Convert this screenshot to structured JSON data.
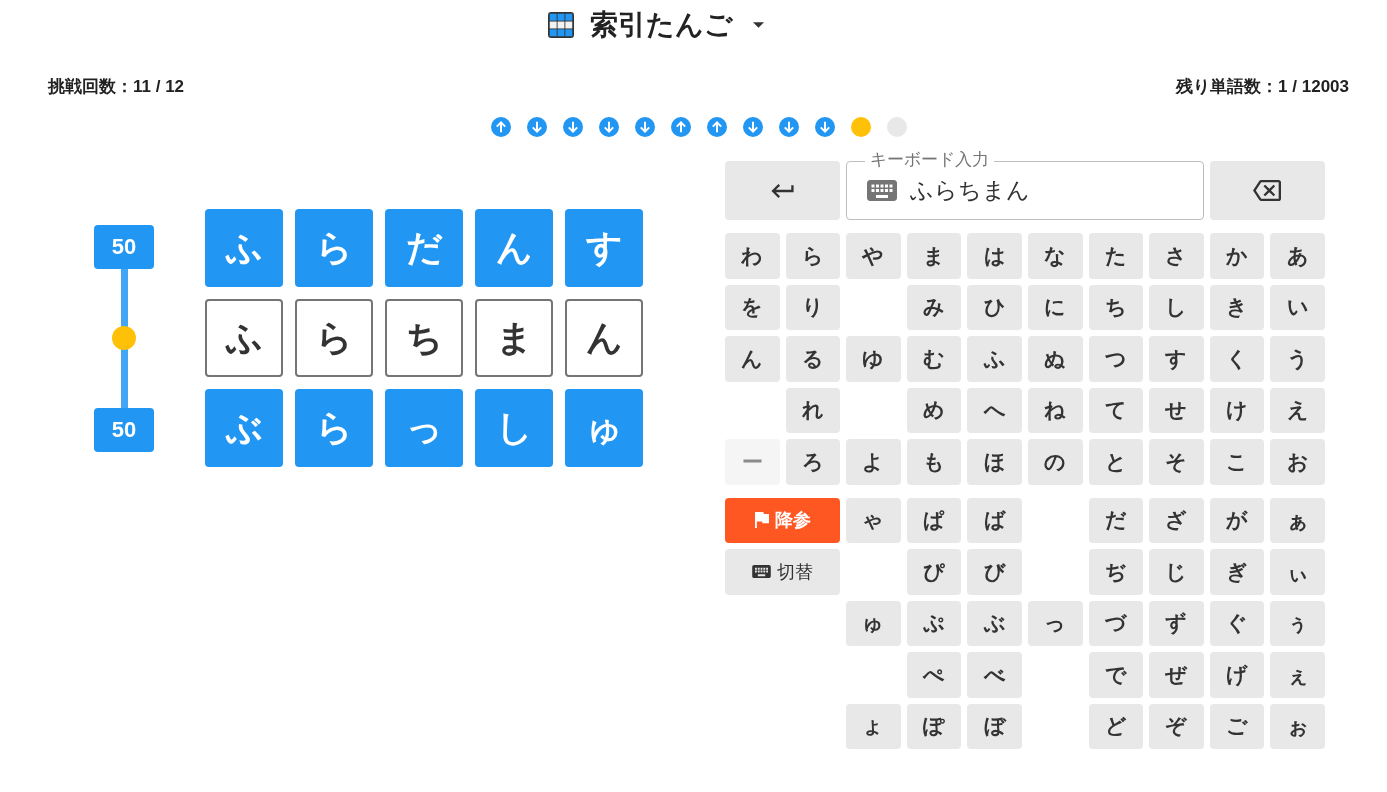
{
  "header": {
    "title": "索引たんご"
  },
  "stats": {
    "attempts": "挑戦回数：11 / 12",
    "remaining_words": "残り単語数：1 / 12003"
  },
  "attempt_history": [
    {
      "kind": "up"
    },
    {
      "kind": "down"
    },
    {
      "kind": "down"
    },
    {
      "kind": "down"
    },
    {
      "kind": "down"
    },
    {
      "kind": "up"
    },
    {
      "kind": "up"
    },
    {
      "kind": "down"
    },
    {
      "kind": "down"
    },
    {
      "kind": "down"
    },
    {
      "kind": "current"
    },
    {
      "kind": "pending"
    }
  ],
  "range_slider": {
    "upper_label": "50",
    "lower_label": "50",
    "level": 0.5
  },
  "word_grid": [
    {
      "kind": "bound",
      "tiles": [
        "ふ",
        "ら",
        "だ",
        "ん",
        "す"
      ]
    },
    {
      "kind": "guess",
      "tiles": [
        "ふ",
        "ら",
        "ち",
        "ま",
        "ん"
      ]
    },
    {
      "kind": "bound",
      "tiles": [
        "ぶ",
        "ら",
        "っ",
        "し",
        "ゅ"
      ]
    }
  ],
  "keyboard": {
    "input": {
      "label": "キーボード入力",
      "value": "ふらちまん"
    },
    "kana_rows": [
      [
        {
          "label": "わ",
          "disabled": false
        },
        {
          "label": "ら",
          "disabled": false
        },
        {
          "label": "や",
          "disabled": false
        },
        {
          "label": "ま",
          "disabled": false
        },
        {
          "label": "は",
          "disabled": false
        },
        {
          "label": "な",
          "disabled": false
        },
        {
          "label": "た",
          "disabled": false
        },
        {
          "label": "さ",
          "disabled": false
        },
        {
          "label": "か",
          "disabled": false
        },
        {
          "label": "あ",
          "disabled": false
        }
      ],
      [
        {
          "label": "を",
          "disabled": false
        },
        {
          "label": "り",
          "disabled": false
        },
        null,
        {
          "label": "み",
          "disabled": false
        },
        {
          "label": "ひ",
          "disabled": false
        },
        {
          "label": "に",
          "disabled": false
        },
        {
          "label": "ち",
          "disabled": false
        },
        {
          "label": "し",
          "disabled": false
        },
        {
          "label": "き",
          "disabled": false
        },
        {
          "label": "い",
          "disabled": false
        }
      ],
      [
        {
          "label": "ん",
          "disabled": false
        },
        {
          "label": "る",
          "disabled": false
        },
        {
          "label": "ゆ",
          "disabled": false
        },
        {
          "label": "む",
          "disabled": false
        },
        {
          "label": "ふ",
          "disabled": false
        },
        {
          "label": "ぬ",
          "disabled": false
        },
        {
          "label": "つ",
          "disabled": false
        },
        {
          "label": "す",
          "disabled": false
        },
        {
          "label": "く",
          "disabled": false
        },
        {
          "label": "う",
          "disabled": false
        }
      ],
      [
        null,
        {
          "label": "れ",
          "disabled": false
        },
        null,
        {
          "label": "め",
          "disabled": false
        },
        {
          "label": "へ",
          "disabled": false
        },
        {
          "label": "ね",
          "disabled": false
        },
        {
          "label": "て",
          "disabled": false
        },
        {
          "label": "せ",
          "disabled": false
        },
        {
          "label": "け",
          "disabled": false
        },
        {
          "label": "え",
          "disabled": false
        }
      ],
      [
        {
          "label": "ー",
          "disabled": true
        },
        {
          "label": "ろ",
          "disabled": false
        },
        {
          "label": "よ",
          "disabled": false
        },
        {
          "label": "も",
          "disabled": false
        },
        {
          "label": "ほ",
          "disabled": false
        },
        {
          "label": "の",
          "disabled": false
        },
        {
          "label": "と",
          "disabled": false
        },
        {
          "label": "そ",
          "disabled": false
        },
        {
          "label": "こ",
          "disabled": false
        },
        {
          "label": "お",
          "disabled": false
        }
      ]
    ],
    "action_buttons": [
      {
        "kind": "surrender",
        "label": "降参"
      },
      {
        "kind": "switch",
        "label": "切替"
      }
    ],
    "small_kana_rows": [
      [
        {
          "label": "ゃ",
          "disabled": false
        },
        {
          "label": "ぱ",
          "disabled": false
        },
        {
          "label": "ば",
          "disabled": false
        },
        null,
        {
          "label": "だ",
          "disabled": false
        },
        {
          "label": "ざ",
          "disabled": false
        },
        {
          "label": "が",
          "disabled": false
        },
        {
          "label": "ぁ",
          "disabled": false
        }
      ],
      [
        null,
        {
          "label": "ぴ",
          "disabled": false
        },
        {
          "label": "び",
          "disabled": false
        },
        null,
        {
          "label": "ぢ",
          "disabled": false
        },
        {
          "label": "じ",
          "disabled": false
        },
        {
          "label": "ぎ",
          "disabled": false
        },
        {
          "label": "ぃ",
          "disabled": false
        }
      ],
      [
        {
          "label": "ゅ",
          "disabled": false
        },
        {
          "label": "ぷ",
          "disabled": false
        },
        {
          "label": "ぶ",
          "disabled": false
        },
        {
          "label": "っ",
          "disabled": false
        },
        {
          "label": "づ",
          "disabled": false
        },
        {
          "label": "ず",
          "disabled": false
        },
        {
          "label": "ぐ",
          "disabled": false
        },
        {
          "label": "ぅ",
          "disabled": false
        }
      ],
      [
        null,
        {
          "label": "ぺ",
          "disabled": false
        },
        {
          "label": "べ",
          "disabled": false
        },
        null,
        {
          "label": "で",
          "disabled": false
        },
        {
          "label": "ぜ",
          "disabled": false
        },
        {
          "label": "げ",
          "disabled": false
        },
        {
          "label": "ぇ",
          "disabled": false
        }
      ],
      [
        {
          "label": "ょ",
          "disabled": false
        },
        {
          "label": "ぽ",
          "disabled": false
        },
        {
          "label": "ぼ",
          "disabled": false
        },
        null,
        {
          "label": "ど",
          "disabled": false
        },
        {
          "label": "ぞ",
          "disabled": false
        },
        {
          "label": "ご",
          "disabled": false
        },
        {
          "label": "ぉ",
          "disabled": false
        }
      ]
    ]
  }
}
